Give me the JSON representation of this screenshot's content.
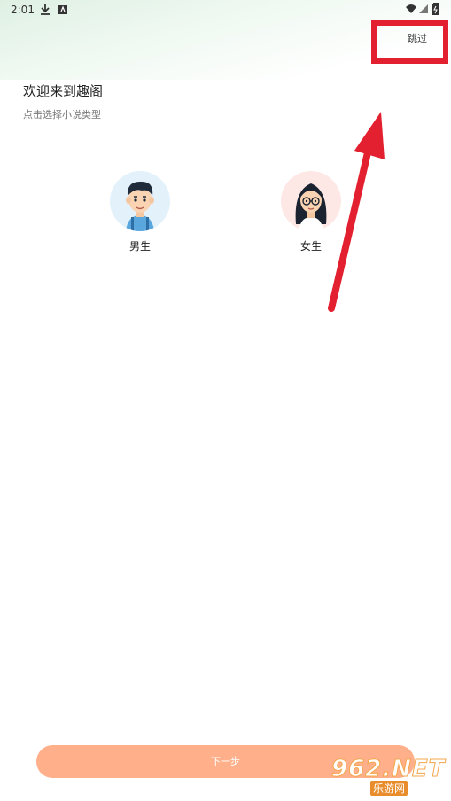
{
  "status_bar": {
    "time": "2:01",
    "icons": [
      "download-icon",
      "notification-icon",
      "wifi-icon",
      "signal-icon",
      "battery-icon"
    ]
  },
  "header": {
    "skip_label": "跳过"
  },
  "welcome": {
    "title": "欢迎来到趣阁",
    "subtitle": "点击选择小说类型"
  },
  "genders": [
    {
      "label": "男生",
      "icon": "boy-avatar-icon"
    },
    {
      "label": "女生",
      "icon": "girl-avatar-icon"
    }
  ],
  "footer": {
    "next_label": "下一步"
  },
  "watermark": {
    "brand": "962.NET",
    "sub": "乐游网"
  },
  "colors": {
    "annotation_red": "#e3202f",
    "next_button": "#ffb08a",
    "male_avatar_bg": "#e3f1fb",
    "female_avatar_bg": "#fde8e6"
  }
}
